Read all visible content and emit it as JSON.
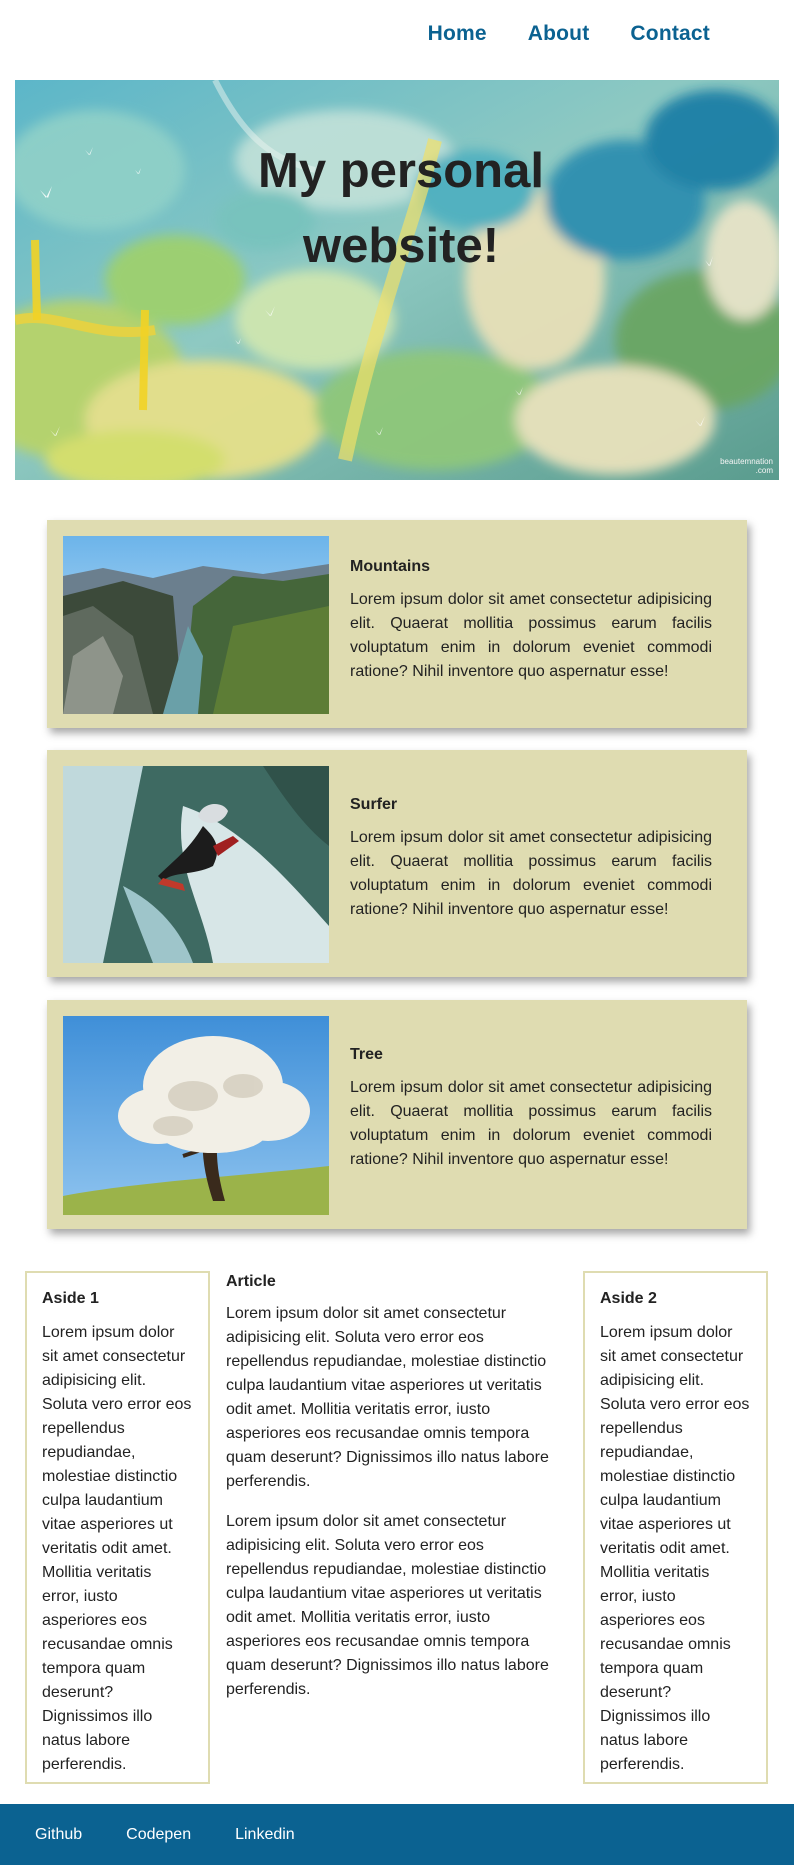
{
  "nav": {
    "items": [
      {
        "label": "Home"
      },
      {
        "label": "About"
      },
      {
        "label": "Contact"
      }
    ]
  },
  "hero": {
    "title_line1": "My personal",
    "title_line2": "website!",
    "watermark_line1": "beautemnation",
    "watermark_line2": ".com"
  },
  "cards": [
    {
      "title": "Mountains",
      "body": "Lorem ipsum dolor sit amet consectetur adipisicing elit. Quaerat mollitia possimus earum facilis voluptatum enim in dolorum eveniet commodi ratione? Nihil inventore quo aspernatur esse!",
      "image": "mountain-fjord-photo"
    },
    {
      "title": "Surfer",
      "body": "Lorem ipsum dolor sit amet consectetur adipisicing elit. Quaerat mollitia possimus earum facilis voluptatum enim in dolorum eveniet commodi ratione? Nihil inventore quo aspernatur esse!",
      "image": "whitewater-kayaker-photo"
    },
    {
      "title": "Tree",
      "body": "Lorem ipsum dolor sit amet consectetur adipisicing elit. Quaerat mollitia possimus earum facilis voluptatum enim in dolorum eveniet commodi ratione? Nihil inventore quo aspernatur esse!",
      "image": "blossoming-tree-photo"
    }
  ],
  "aside1": {
    "title": "Aside 1",
    "body": "Lorem ipsum dolor sit amet consectetur adipisicing elit. Soluta vero error eos repellendus repudiandae, molestiae distinctio culpa laudantium vitae asperiores ut veritatis odit amet. Mollitia veritatis error, iusto asperiores eos recusandae omnis tempora quam deserunt? Dignissimos illo natus labore perferendis."
  },
  "article": {
    "title": "Article",
    "paragraphs": [
      "Lorem ipsum dolor sit amet consectetur adipisicing elit. Soluta vero error eos repellendus repudiandae, molestiae distinctio culpa laudantium vitae asperiores ut veritatis odit amet. Mollitia veritatis error, iusto asperiores eos recusandae omnis tempora quam deserunt? Dignissimos illo natus labore perferendis.",
      "Lorem ipsum dolor sit amet consectetur adipisicing elit. Soluta vero error eos repellendus repudiandae, molestiae distinctio culpa laudantium vitae asperiores ut veritatis odit amet. Mollitia veritatis error, iusto asperiores eos recusandae omnis tempora quam deserunt? Dignissimos illo natus labore perferendis."
    ]
  },
  "aside2": {
    "title": "Aside 2",
    "body": "Lorem ipsum dolor sit amet consectetur adipisicing elit. Soluta vero error eos repellendus repudiandae, molestiae distinctio culpa laudantium vitae asperiores ut veritatis odit amet. Mollitia veritatis error, iusto asperiores eos recusandae omnis tempora quam deserunt? Dignissimos illo natus labore perferendis."
  },
  "footer": {
    "links": [
      {
        "label": "Github"
      },
      {
        "label": "Codepen"
      },
      {
        "label": "Linkedin"
      }
    ]
  },
  "colors": {
    "nav_link": "#0b6291",
    "card_background": "#dfdcb1",
    "footer_background": "#0b6291",
    "aside_border": "#dfdcb1"
  }
}
